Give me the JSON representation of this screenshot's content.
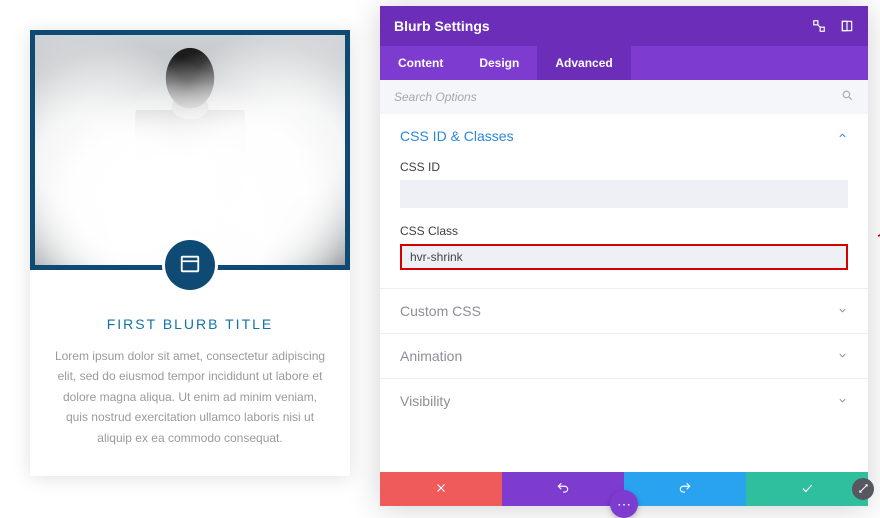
{
  "preview": {
    "title": "FIRST BLURB TITLE",
    "body": "Lorem ipsum dolor sit amet, consectetur adipiscing elit, sed do eiusmod tempor incididunt ut labore et dolore magna aliqua. Ut enim ad minim veniam, quis nostrud exercitation ullamco laboris nisi ut aliquip ex ea commodo consequat."
  },
  "panel": {
    "title": "Blurb Settings",
    "tabs": {
      "content": "Content",
      "design": "Design",
      "advanced": "Advanced"
    },
    "search_placeholder": "Search Options",
    "sections": {
      "css": {
        "title": "CSS ID & Classes",
        "css_id_label": "CSS ID",
        "css_id_value": "",
        "css_class_label": "CSS Class",
        "css_class_value": "hvr-shrink"
      },
      "custom_css": "Custom CSS",
      "animation": "Animation",
      "visibility": "Visibility"
    }
  },
  "colors": {
    "purple_dark": "#6c2eb9",
    "purple": "#7e3bd0",
    "red": "#ef5a5a",
    "blue": "#29a3ef",
    "green": "#2fbf9e",
    "card_border": "#0e4a73",
    "highlight": "#d40000"
  }
}
